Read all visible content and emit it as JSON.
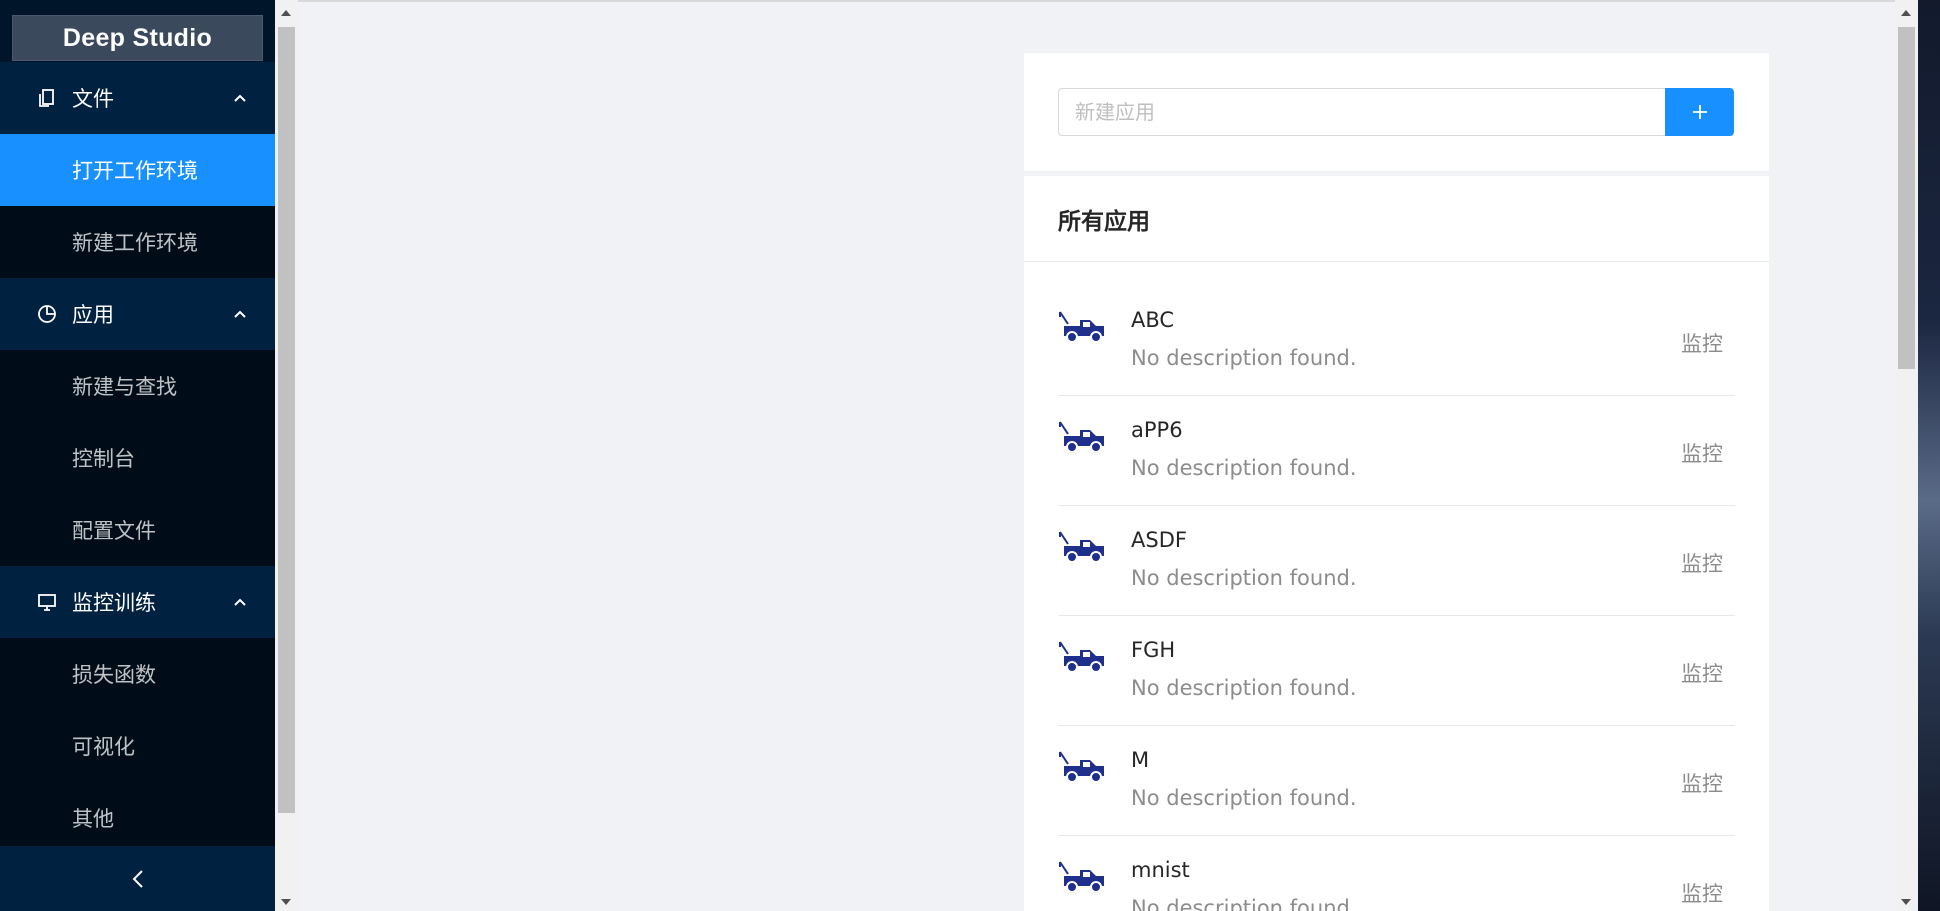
{
  "sidebar": {
    "logo": "Deep Studio",
    "groups": [
      {
        "label": "文件",
        "icon": "file-copy-icon",
        "items": [
          "打开工作环境",
          "新建工作环境"
        ]
      },
      {
        "label": "应用",
        "icon": "pie-chart-icon",
        "items": [
          "新建与查找",
          "控制台",
          "配置文件"
        ]
      },
      {
        "label": "监控训练",
        "icon": "desktop-icon",
        "items": [
          "损失函数",
          "可视化",
          "其他"
        ]
      }
    ],
    "active_item": "打开工作环境",
    "collapse_icon": "chevron-left-icon"
  },
  "search": {
    "placeholder": "新建应用",
    "add_icon": "plus-icon"
  },
  "list": {
    "title": "所有应用",
    "action_label": "监控",
    "item_icon": "tow-truck-icon",
    "apps": [
      {
        "name": "ABC",
        "description": "No description found."
      },
      {
        "name": "aPP6",
        "description": "No description found."
      },
      {
        "name": "ASDF",
        "description": "No description found."
      },
      {
        "name": "FGH",
        "description": "No description found."
      },
      {
        "name": "M",
        "description": "No description found."
      },
      {
        "name": "mnist",
        "description": "No description found."
      }
    ]
  },
  "colors": {
    "sidebar_bg": "#001529",
    "group_bg": "#002140",
    "submenu_bg": "#000c17",
    "primary": "#1890ff",
    "truck": "#1f2f8c"
  }
}
